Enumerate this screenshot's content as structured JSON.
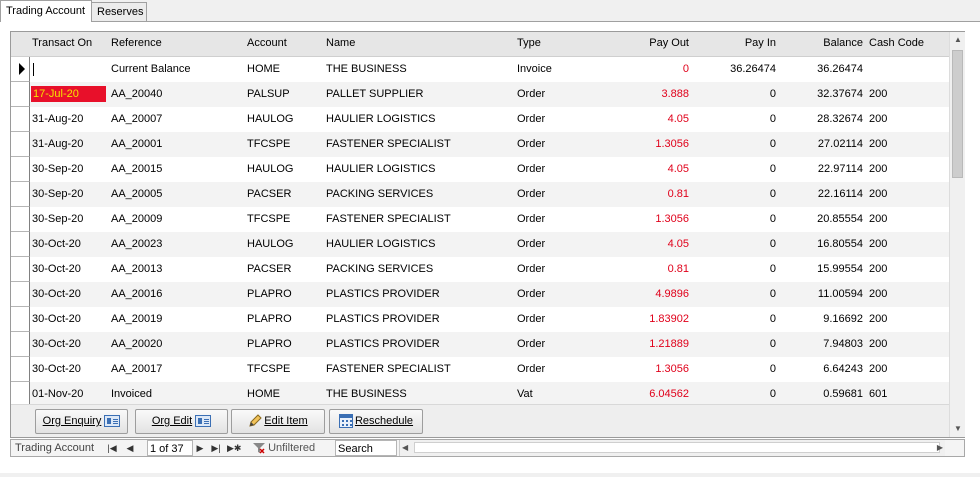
{
  "tabs": [
    {
      "label": "Trading Account",
      "active": true
    },
    {
      "label": "Reserves",
      "active": false
    }
  ],
  "columns": {
    "transact_on": "Transact On",
    "reference": "Reference",
    "account": "Account",
    "name": "Name",
    "type": "Type",
    "pay_out": "Pay Out",
    "pay_in": "Pay In",
    "balance": "Balance",
    "cash_code": "Cash Code"
  },
  "rows": [
    {
      "transact_on": "",
      "reference": "Current Balance",
      "account": "HOME",
      "name": "THE BUSINESS",
      "type": "Invoice",
      "pay_out": "0",
      "pay_in": "36.26474",
      "balance": "36.26474",
      "cash_code": ""
    },
    {
      "transact_on": "17-Jul-20",
      "reference": "AA_20040",
      "account": "PALSUP",
      "name": "PALLET SUPPLIER",
      "type": "Order",
      "pay_out": "3.888",
      "pay_in": "0",
      "balance": "32.37674",
      "cash_code": "200"
    },
    {
      "transact_on": "31-Aug-20",
      "reference": "AA_20007",
      "account": "HAULOG",
      "name": "HAULIER LOGISTICS",
      "type": "Order",
      "pay_out": "4.05",
      "pay_in": "0",
      "balance": "28.32674",
      "cash_code": "200"
    },
    {
      "transact_on": "31-Aug-20",
      "reference": "AA_20001",
      "account": "TFCSPE",
      "name": "FASTENER SPECIALIST",
      "type": "Order",
      "pay_out": "1.3056",
      "pay_in": "0",
      "balance": "27.02114",
      "cash_code": "200"
    },
    {
      "transact_on": "30-Sep-20",
      "reference": "AA_20015",
      "account": "HAULOG",
      "name": "HAULIER LOGISTICS",
      "type": "Order",
      "pay_out": "4.05",
      "pay_in": "0",
      "balance": "22.97114",
      "cash_code": "200"
    },
    {
      "transact_on": "30-Sep-20",
      "reference": "AA_20005",
      "account": "PACSER",
      "name": "PACKING SERVICES",
      "type": "Order",
      "pay_out": "0.81",
      "pay_in": "0",
      "balance": "22.16114",
      "cash_code": "200"
    },
    {
      "transact_on": "30-Sep-20",
      "reference": "AA_20009",
      "account": "TFCSPE",
      "name": "FASTENER SPECIALIST",
      "type": "Order",
      "pay_out": "1.3056",
      "pay_in": "0",
      "balance": "20.85554",
      "cash_code": "200"
    },
    {
      "transact_on": "30-Oct-20",
      "reference": "AA_20023",
      "account": "HAULOG",
      "name": "HAULIER LOGISTICS",
      "type": "Order",
      "pay_out": "4.05",
      "pay_in": "0",
      "balance": "16.80554",
      "cash_code": "200"
    },
    {
      "transact_on": "30-Oct-20",
      "reference": "AA_20013",
      "account": "PACSER",
      "name": "PACKING SERVICES",
      "type": "Order",
      "pay_out": "0.81",
      "pay_in": "0",
      "balance": "15.99554",
      "cash_code": "200"
    },
    {
      "transact_on": "30-Oct-20",
      "reference": "AA_20016",
      "account": "PLAPRO",
      "name": "PLASTICS PROVIDER",
      "type": "Order",
      "pay_out": "4.9896",
      "pay_in": "0",
      "balance": "11.00594",
      "cash_code": "200"
    },
    {
      "transact_on": "30-Oct-20",
      "reference": "AA_20019",
      "account": "PLAPRO",
      "name": "PLASTICS PROVIDER",
      "type": "Order",
      "pay_out": "1.83902",
      "pay_in": "0",
      "balance": "9.16692",
      "cash_code": "200"
    },
    {
      "transact_on": "30-Oct-20",
      "reference": "AA_20020",
      "account": "PLAPRO",
      "name": "PLASTICS PROVIDER",
      "type": "Order",
      "pay_out": "1.21889",
      "pay_in": "0",
      "balance": "7.94803",
      "cash_code": "200"
    },
    {
      "transact_on": "30-Oct-20",
      "reference": "AA_20017",
      "account": "TFCSPE",
      "name": "FASTENER SPECIALIST",
      "type": "Order",
      "pay_out": "1.3056",
      "pay_in": "0",
      "balance": "6.64243",
      "cash_code": "200"
    },
    {
      "transact_on": "01-Nov-20",
      "reference": "Invoiced",
      "account": "HOME",
      "name": "THE BUSINESS",
      "type": "Vat",
      "pay_out": "6.04562",
      "pay_in": "0",
      "balance": "0.59681",
      "cash_code": "601"
    }
  ],
  "buttons": {
    "org_enquiry": "Org Enquiry",
    "org_edit": "Org Edit",
    "edit_item": "Edit Item",
    "reschedule": "Reschedule"
  },
  "navigator": {
    "label": "Trading Account",
    "record": "1 of 37",
    "filter": "Unfiltered",
    "search": "Search"
  },
  "colors": {
    "pay_out_text": "#e0001a",
    "highlight_bg": "#e8102a",
    "highlight_text": "#f5e400"
  },
  "icons": {
    "current_row": "row-selector-arrow-icon",
    "org_enquiry": "contact-card-icon",
    "org_edit": "contact-card-icon",
    "edit_item": "pencil-icon",
    "reschedule": "calendar-icon",
    "filter": "filter-funnel-icon"
  }
}
